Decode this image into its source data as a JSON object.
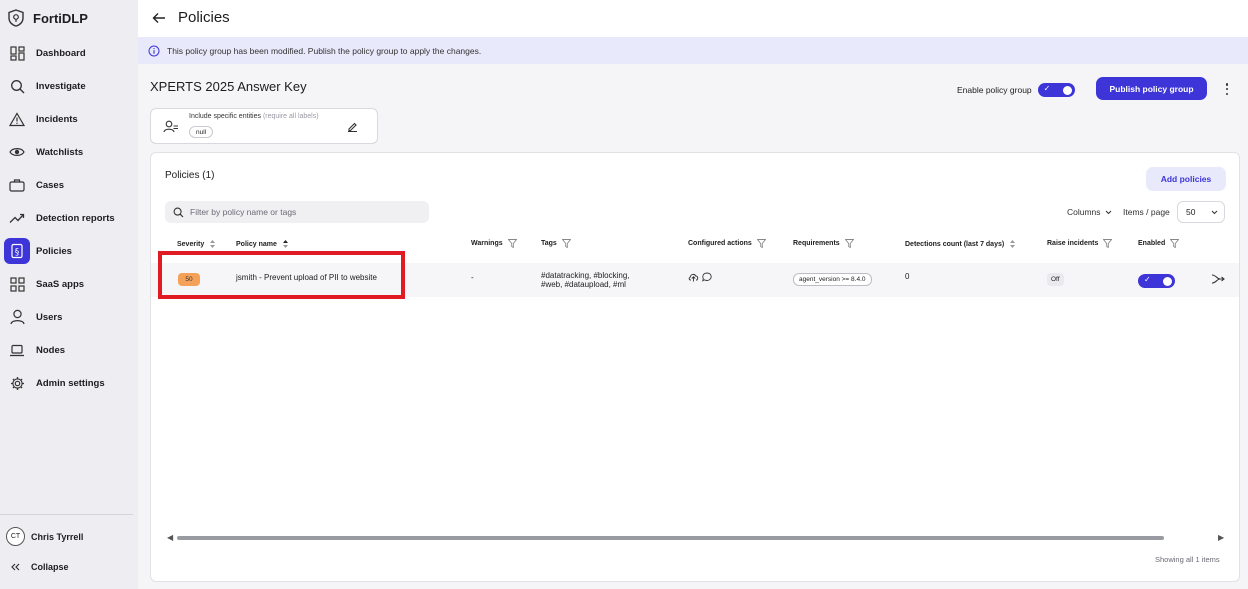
{
  "app": {
    "name": "FortiDLP"
  },
  "sidebar": {
    "items": [
      {
        "label": "Dashboard",
        "icon": "dashboard-icon"
      },
      {
        "label": "Investigate",
        "icon": "search-icon"
      },
      {
        "label": "Incidents",
        "icon": "warning-icon"
      },
      {
        "label": "Watchlists",
        "icon": "eye-icon"
      },
      {
        "label": "Cases",
        "icon": "briefcase-icon"
      },
      {
        "label": "Detection reports",
        "icon": "trend-icon"
      },
      {
        "label": "Policies",
        "icon": "policy-icon",
        "active": true
      },
      {
        "label": "SaaS apps",
        "icon": "apps-icon"
      },
      {
        "label": "Users",
        "icon": "user-icon"
      },
      {
        "label": "Nodes",
        "icon": "laptop-icon"
      },
      {
        "label": "Admin settings",
        "icon": "gear-icon"
      }
    ],
    "user": {
      "initials": "CT",
      "name": "Chris Tyrrell"
    },
    "collapse_label": "Collapse"
  },
  "header": {
    "title": "Policies"
  },
  "banner": {
    "text": "This policy group has been modified. Publish the policy group to apply the changes."
  },
  "group": {
    "title": "XPERTS 2025 Answer Key",
    "enable_label": "Enable policy group",
    "enabled": true,
    "publish_label": "Publish policy group",
    "entities": {
      "label": "Include specific entities",
      "hint": "(require all labels)",
      "chip": "null"
    }
  },
  "policies": {
    "heading": "Policies (1)",
    "add_label": "Add policies",
    "filter_placeholder": "Filter by policy name or tags",
    "columns_label": "Columns",
    "items_per_page_label": "Items / page",
    "items_per_page_value": "50",
    "columns": {
      "severity": "Severity",
      "policy_name": "Policy name",
      "warnings": "Warnings",
      "tags": "Tags",
      "configured_actions": "Configured actions",
      "requirements": "Requirements",
      "detections": "Detections count (last 7 days)",
      "raise_incidents": "Raise incidents",
      "enabled": "Enabled"
    },
    "rows": [
      {
        "severity": "50",
        "name": "jsmith - Prevent upload of PII to website",
        "warnings": "-",
        "tags_line1": "#datatracking, #blocking,",
        "tags_line2": "#web, #dataupload, #ml",
        "requirement": "agent_version >= 8.4.0",
        "detections": "0",
        "raise_incidents": "Off",
        "enabled": true
      }
    ],
    "showing": "Showing all 1 items"
  },
  "colors": {
    "accent": "#3d35d8",
    "severity_medium": "#f6a15a",
    "highlight": "#e01b24"
  }
}
